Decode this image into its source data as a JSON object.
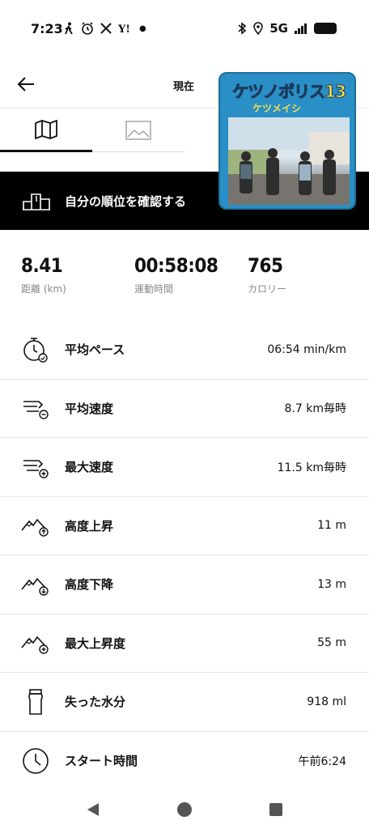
{
  "status_bar": {
    "time": "7:23",
    "left_icons": [
      "walk-icon",
      "alarm-icon",
      "x-icon",
      "yahoo-icon",
      "dot-icon"
    ],
    "network": "5G",
    "right_icons": [
      "bluetooth-icon",
      "location-icon",
      "signal-icon",
      "battery-icon"
    ]
  },
  "app_bar": {
    "title": "現在"
  },
  "tabs": [
    {
      "icon": "map-icon",
      "selected": true
    },
    {
      "icon": "image-icon",
      "selected": false
    }
  ],
  "album_overlay": {
    "title": "ケツノポリス13",
    "artist": "ケツメイシ"
  },
  "rank_banner": {
    "label": "自分の順位を確認する"
  },
  "stats": [
    {
      "value": "8.41",
      "label": "距離 (km)"
    },
    {
      "value": "00:58:08",
      "label": "運動時間"
    },
    {
      "value": "765",
      "label": "カロリー"
    }
  ],
  "metrics": [
    {
      "icon": "stopwatch-icon",
      "label": "平均ペース",
      "value": "06:54 min/km"
    },
    {
      "icon": "speed-avg-icon",
      "label": "平均速度",
      "value": "8.7 km毎時"
    },
    {
      "icon": "speed-max-icon",
      "label": "最大速度",
      "value": "11.5 km毎時"
    },
    {
      "icon": "elevation-up-icon",
      "label": "高度上昇",
      "value": "11 m"
    },
    {
      "icon": "elevation-down-icon",
      "label": "高度下降",
      "value": "13 m"
    },
    {
      "icon": "elevation-max-icon",
      "label": "最大上昇度",
      "value": "55 m"
    },
    {
      "icon": "bottle-icon",
      "label": "失った水分",
      "value": "918 ml"
    },
    {
      "icon": "clock-icon",
      "label": "スタート時間",
      "value": "午前6:24"
    }
  ],
  "nav_bar": {
    "buttons": [
      "back-triangle-icon",
      "home-circle-icon",
      "recents-square-icon"
    ]
  }
}
